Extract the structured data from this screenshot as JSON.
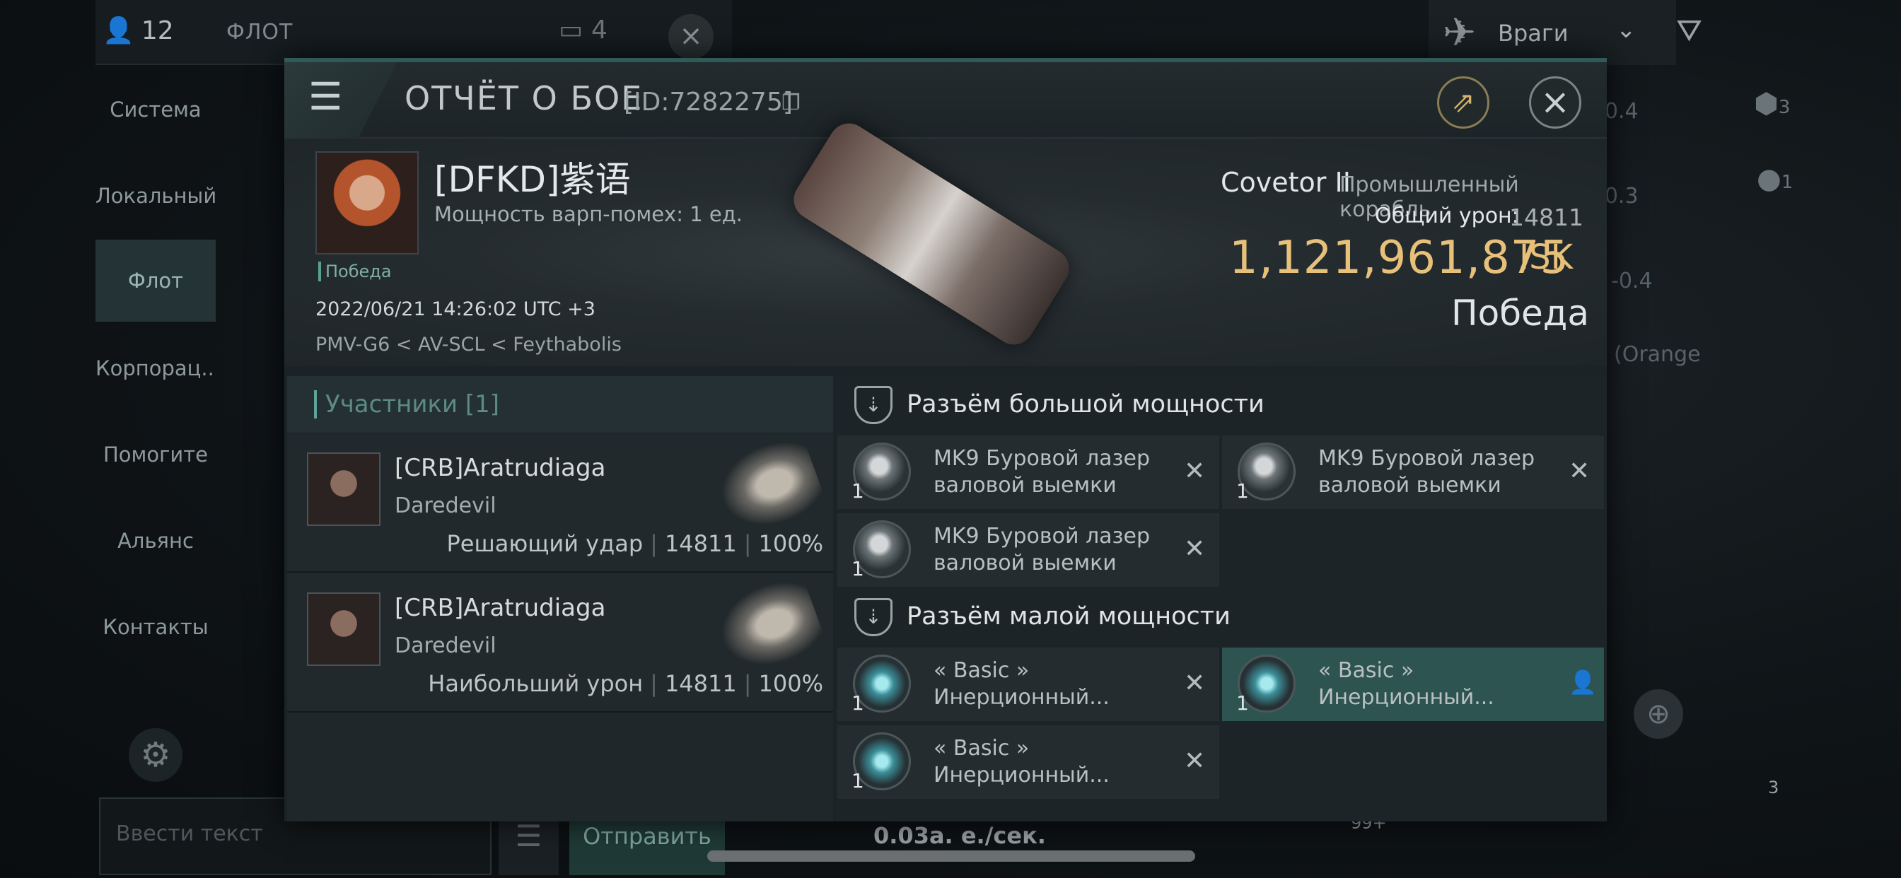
{
  "background": {
    "member_count": "12",
    "fleet_label": "ФЛОТ",
    "fleet_count": "4",
    "enemy_dropdown": "Враги",
    "nav_items": [
      "Система",
      "Локальный",
      "Флот",
      "Корпорац...",
      "Помогите",
      "Альянс",
      "Контакты"
    ],
    "chat_placeholder": "Ввести текст",
    "send_label": "Отправить",
    "rate": "0.03а. е./сек.",
    "right_values": [
      "-0.4",
      "-0.3",
      "-0.4",
      "(Orange"
    ],
    "side_counts": [
      "3",
      "1"
    ],
    "notif_badge": "99+",
    "bottom_count": "3"
  },
  "dialog": {
    "title": "ОТЧЁТ О БОЕ",
    "report_id": "[ID:7282275]",
    "victim": {
      "name": "[DFKD]紫语",
      "warp_disrupt": "Мощность варп-помех: 1 ед.",
      "status_tag": "Победа",
      "timestamp": "2022/06/21 14:26:02 UTC +3",
      "location": "PMV-G6 < AV-SCL < Feythabolis",
      "ship_name": "Covetor II",
      "ship_class": "Промышленный корабль",
      "total_damage_label": "Общий урон:",
      "total_damage": "14811",
      "isk_value": "1,121,961,875",
      "isk_unit": "ISK",
      "result": "Победа"
    },
    "participants": {
      "header": "Участники [1]",
      "rows": [
        {
          "name": "[CRB]Aratrudiaga",
          "ship": "Daredevil",
          "role": "Решающий удар",
          "damage": "14811",
          "percent": "100%"
        },
        {
          "name": "[CRB]Aratrudiaga",
          "ship": "Daredevil",
          "role": "Наибольший урон",
          "damage": "14811",
          "percent": "100%"
        }
      ]
    },
    "fittings": {
      "high_slots_title": "Разъём большой мощности",
      "high_modules": [
        {
          "qty": "1",
          "line1": "MK9 Буровой лазер",
          "line2": "валовой выемки"
        },
        {
          "qty": "1",
          "line1": "MK9 Буровой лазер",
          "line2": "валовой выемки"
        },
        {
          "qty": "1",
          "line1": "MK9 Буровой лазер",
          "line2": "валовой выемки"
        }
      ],
      "low_slots_title": "Разъём малой мощности",
      "low_modules": [
        {
          "qty": "1",
          "line1": "« Basic »",
          "line2": "Инерционный..."
        },
        {
          "qty": "1",
          "line1": "« Basic »",
          "line2": "Инерционный..."
        },
        {
          "qty": "1",
          "line1": "« Basic »",
          "line2": "Инерционный..."
        }
      ]
    }
  }
}
